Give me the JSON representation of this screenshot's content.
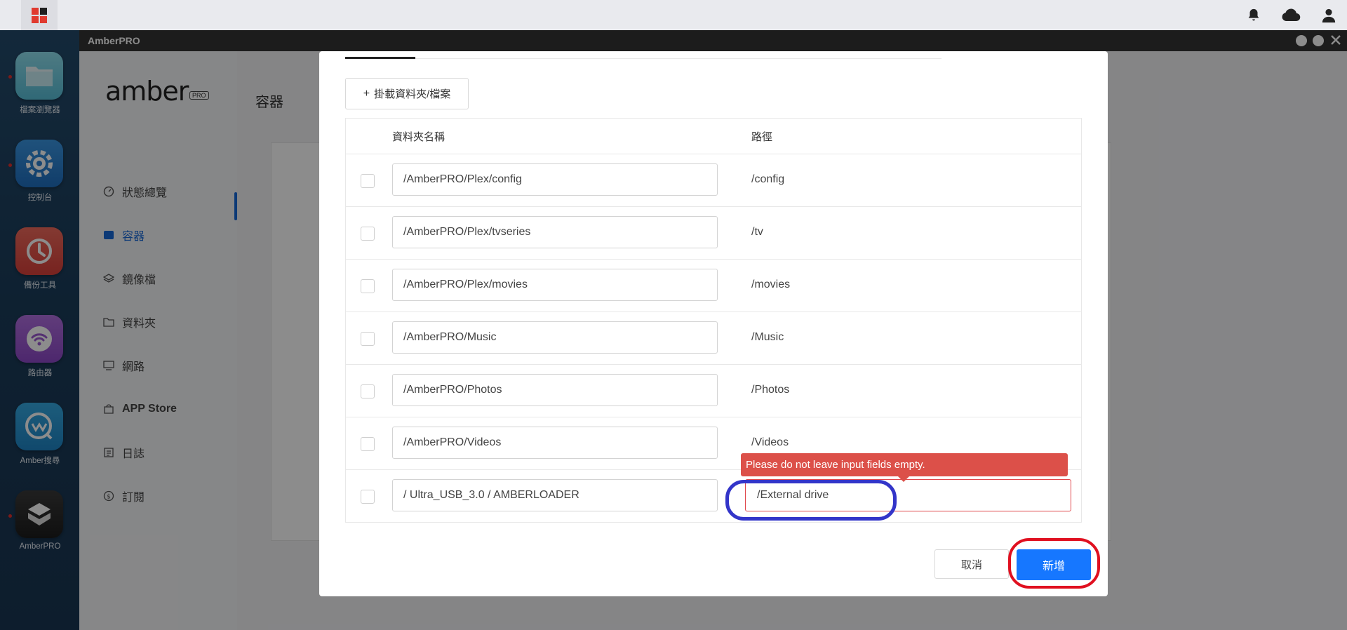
{
  "window": {
    "title": "AmberPRO"
  },
  "dock": {
    "apps": [
      {
        "label": "檔案瀏覽器",
        "icon": "folder-icon",
        "color": "#7fd3e6"
      },
      {
        "label": "控制台",
        "icon": "gear-icon",
        "color": "#2f86d6"
      },
      {
        "label": "備份工具",
        "icon": "backup-clock-icon",
        "color": "#e8524a"
      },
      {
        "label": "路由器",
        "icon": "wifi-icon",
        "color": "#9b59d0"
      },
      {
        "label": "Amber搜尋",
        "icon": "amber-search-icon",
        "color": "#2a9ad6"
      },
      {
        "label": "AmberPRO",
        "icon": "amberpro-cube-icon",
        "color": "#2a2a2a"
      }
    ]
  },
  "sidebar": {
    "logo": "amber",
    "logo_badge": "PRO",
    "items": [
      {
        "label": "狀態總覽",
        "icon": "dashboard-icon"
      },
      {
        "label": "容器",
        "icon": "container-icon"
      },
      {
        "label": "鏡像檔",
        "icon": "layers-icon"
      },
      {
        "label": "資料夾",
        "icon": "folder-outline-icon"
      },
      {
        "label": "網路",
        "icon": "monitor-icon"
      },
      {
        "label": "APP Store",
        "icon": "store-icon"
      },
      {
        "label": "日誌",
        "icon": "log-icon"
      },
      {
        "label": "訂閱",
        "icon": "dollar-icon"
      }
    ]
  },
  "modal": {
    "mount_button": "掛載資料夾/檔案",
    "table": {
      "headers": {
        "folder": "資料夾名稱",
        "path": "路徑"
      },
      "rows": [
        {
          "folder": "/AmberPRO/Plex/config",
          "path": "/config"
        },
        {
          "folder": "/AmberPRO/Plex/tvseries",
          "path": "/tv"
        },
        {
          "folder": "/AmberPRO/Plex/movies",
          "path": "/movies"
        },
        {
          "folder": "/AmberPRO/Music",
          "path": "/Music"
        },
        {
          "folder": "/AmberPRO/Photos",
          "path": "/Photos"
        },
        {
          "folder": "/AmberPRO/Videos",
          "path": "/Videos"
        },
        {
          "folder": "/ Ultra_USB_3.0 / AMBERLOADER",
          "path": "/External drive"
        }
      ]
    },
    "error_tooltip": "Please do not leave input fields empty.",
    "cancel_label": "取消",
    "add_label": "新增"
  }
}
